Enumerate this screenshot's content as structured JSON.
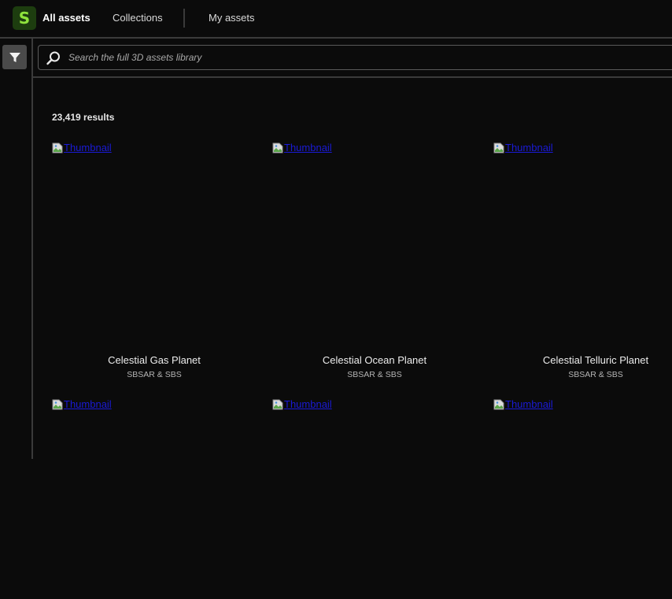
{
  "app": {
    "logo_letter": "S",
    "logo_color": "#8fe33c",
    "logo_bg": "#1d3d0f"
  },
  "nav": {
    "items": [
      {
        "label": "All assets",
        "active": true
      },
      {
        "label": "Collections",
        "active": false
      },
      {
        "label": "My assets",
        "active": false
      }
    ]
  },
  "toolbar": {
    "filter_icon": "filter-funnel-icon"
  },
  "search": {
    "placeholder": "Search the full 3D assets library",
    "value": "",
    "icon": "search-icon"
  },
  "results": {
    "count_label": "23,419 results",
    "cards": [
      {
        "thumb_alt": "Thumbnail",
        "title": "Celestial Gas Planet",
        "subtitle": "SBSAR & SBS"
      },
      {
        "thumb_alt": "Thumbnail",
        "title": "Celestial Ocean Planet",
        "subtitle": "SBSAR & SBS"
      },
      {
        "thumb_alt": "Thumbnail",
        "title": "Celestial Telluric Planet",
        "subtitle": "SBSAR & SBS"
      },
      {
        "thumb_alt": "Thumbnail",
        "title": "",
        "subtitle": ""
      },
      {
        "thumb_alt": "Thumbnail",
        "title": "",
        "subtitle": ""
      },
      {
        "thumb_alt": "Thumbnail",
        "title": "",
        "subtitle": ""
      }
    ]
  }
}
